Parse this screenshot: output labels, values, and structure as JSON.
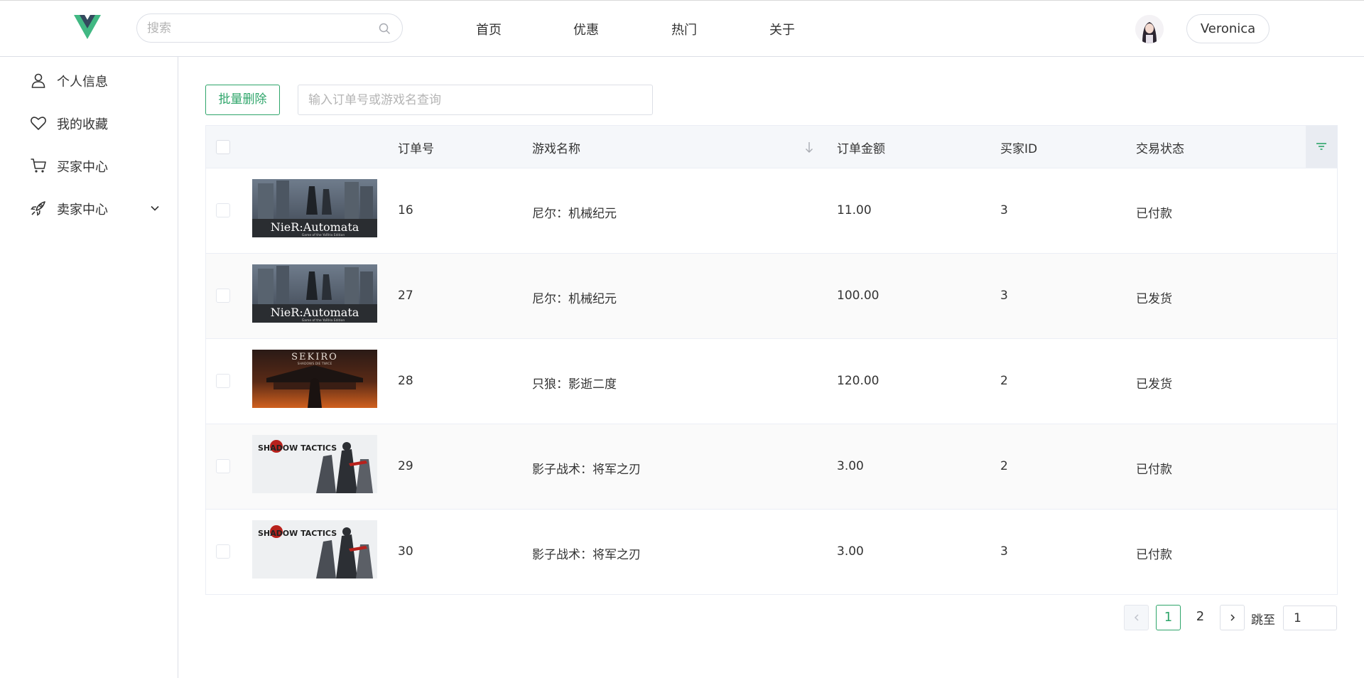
{
  "header": {
    "logo_icon": "vue-logo-icon",
    "search_placeholder": "搜索",
    "nav": [
      {
        "label": "首页"
      },
      {
        "label": "优惠"
      },
      {
        "label": "热门"
      },
      {
        "label": "关于"
      }
    ],
    "user_name": "Veronica"
  },
  "sidebar": {
    "items": [
      {
        "label": "个人信息",
        "icon": "user-icon"
      },
      {
        "label": "我的收藏",
        "icon": "heart-icon"
      },
      {
        "label": "买家中心",
        "icon": "cart-icon"
      },
      {
        "label": "卖家中心",
        "icon": "rocket-icon",
        "expandable": true
      }
    ]
  },
  "toolbar": {
    "batch_delete_label": "批量删除",
    "order_search_placeholder": "输入订单号或游戏名查询"
  },
  "table": {
    "columns": {
      "order_no": "订单号",
      "game_name": "游戏名称",
      "amount": "订单金额",
      "buyer_id": "买家ID",
      "status": "交易状态"
    },
    "rows": [
      {
        "order_no": "16",
        "game_name": "尼尔：机械纪元",
        "amount": "11.00",
        "buyer_id": "3",
        "status": "已付款",
        "cover_text": "NieR:Automata",
        "cover_sub": "Game of the YoRHa Edition"
      },
      {
        "order_no": "27",
        "game_name": "尼尔：机械纪元",
        "amount": "100.00",
        "buyer_id": "3",
        "status": "已发货",
        "cover_text": "NieR:Automata",
        "cover_sub": "Game of the YoRHa Edition"
      },
      {
        "order_no": "28",
        "game_name": "只狼：影逝二度",
        "amount": "120.00",
        "buyer_id": "2",
        "status": "已发货",
        "cover_text": "SEKIRO",
        "cover_sub": "SHADOWS DIE TWICE"
      },
      {
        "order_no": "29",
        "game_name": "影子战术：将军之刃",
        "amount": "3.00",
        "buyer_id": "2",
        "status": "已付款",
        "cover_text": "SHADOW TACTICS",
        "cover_sub": ""
      },
      {
        "order_no": "30",
        "game_name": "影子战术：将军之刃",
        "amount": "3.00",
        "buyer_id": "3",
        "status": "已付款",
        "cover_text": "SHADOW TACTICS",
        "cover_sub": ""
      }
    ]
  },
  "pagination": {
    "pages": [
      "1",
      "2"
    ],
    "current": "1",
    "jump_label": "跳至",
    "jump_value": "1"
  },
  "colors": {
    "accent": "#2ea56a",
    "border": "#dcdfe6",
    "header_bg": "#f5f7fa"
  }
}
